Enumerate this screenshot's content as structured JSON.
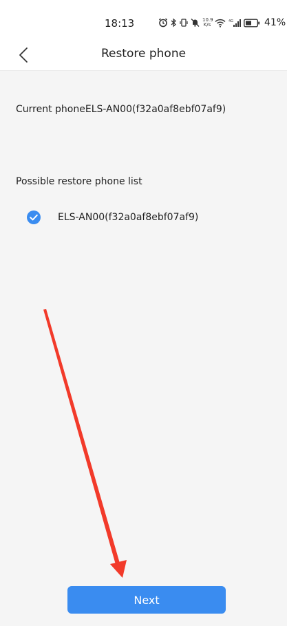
{
  "status_bar": {
    "time": "18:13",
    "net_speed_value": "10.9",
    "net_speed_unit": "K/s",
    "network_type": "4G",
    "battery_percent": "41%"
  },
  "nav": {
    "title": "Restore phone",
    "back_icon": "chevron-left-icon"
  },
  "content": {
    "current_phone_text": "Current phoneELS-AN00(f32a0af8ebf07af9)",
    "list_title": "Possible restore phone list",
    "devices": [
      {
        "label": "ELS-AN00(f32a0af8ebf07af9)",
        "selected": true
      }
    ]
  },
  "actions": {
    "next_label": "Next"
  },
  "colors": {
    "accent": "#3a8cf0",
    "annotation_arrow": "#f23a2a",
    "background": "#f5f5f5"
  }
}
